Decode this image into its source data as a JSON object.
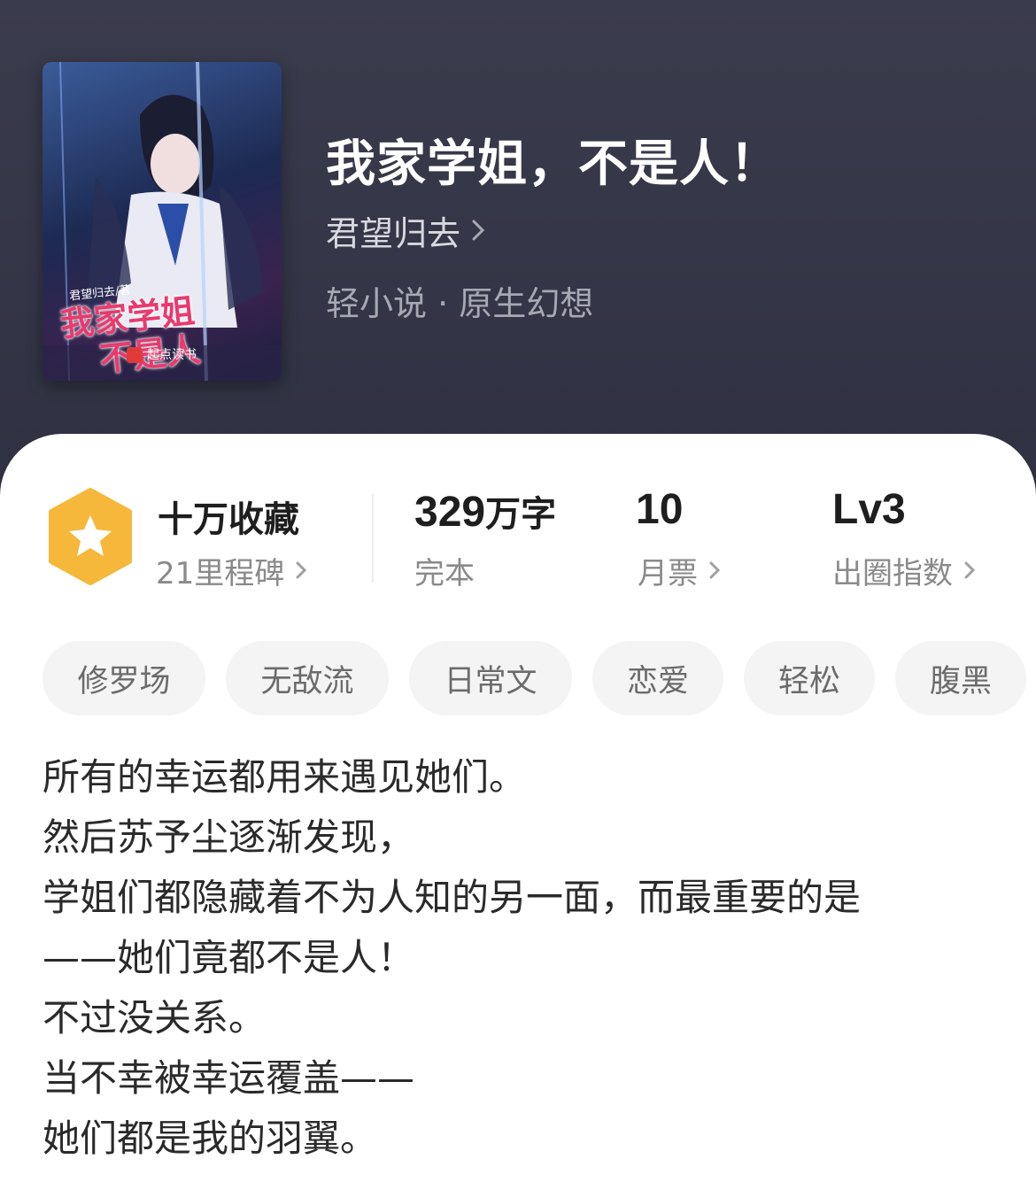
{
  "book": {
    "title": "我家学姐，不是人！",
    "author": "君望归去",
    "category": "轻小说 · 原生幻想"
  },
  "cover": {
    "title_line1": "我家学姐",
    "title_line2": "不是人",
    "author_text": "君望归去/著",
    "brand": "起点读书"
  },
  "stats": {
    "collection": {
      "main": "十万收藏",
      "sub": "21里程碑"
    },
    "words": {
      "number": "329",
      "unit": "万字",
      "sub": "完本"
    },
    "tickets": {
      "main": "10",
      "sub": "月票"
    },
    "level": {
      "main": "Lv3",
      "sub": "出圈指数"
    }
  },
  "tags": [
    "修罗场",
    "无敌流",
    "日常文",
    "恋爱",
    "轻松",
    "腹黑"
  ],
  "intro": [
    "所有的幸运都用来遇见她们。",
    "然后苏予尘逐渐发现，",
    "学姐们都隐藏着不为人知的另一面，而最重要的是",
    "——她们竟都不是人！",
    "不过没关系。",
    "当不幸被幸运覆盖——",
    "她们都是我的羽翼。"
  ],
  "colors": {
    "header_bg": "#363748",
    "badge": "#f5b83a",
    "title_text": "#ffffff"
  }
}
